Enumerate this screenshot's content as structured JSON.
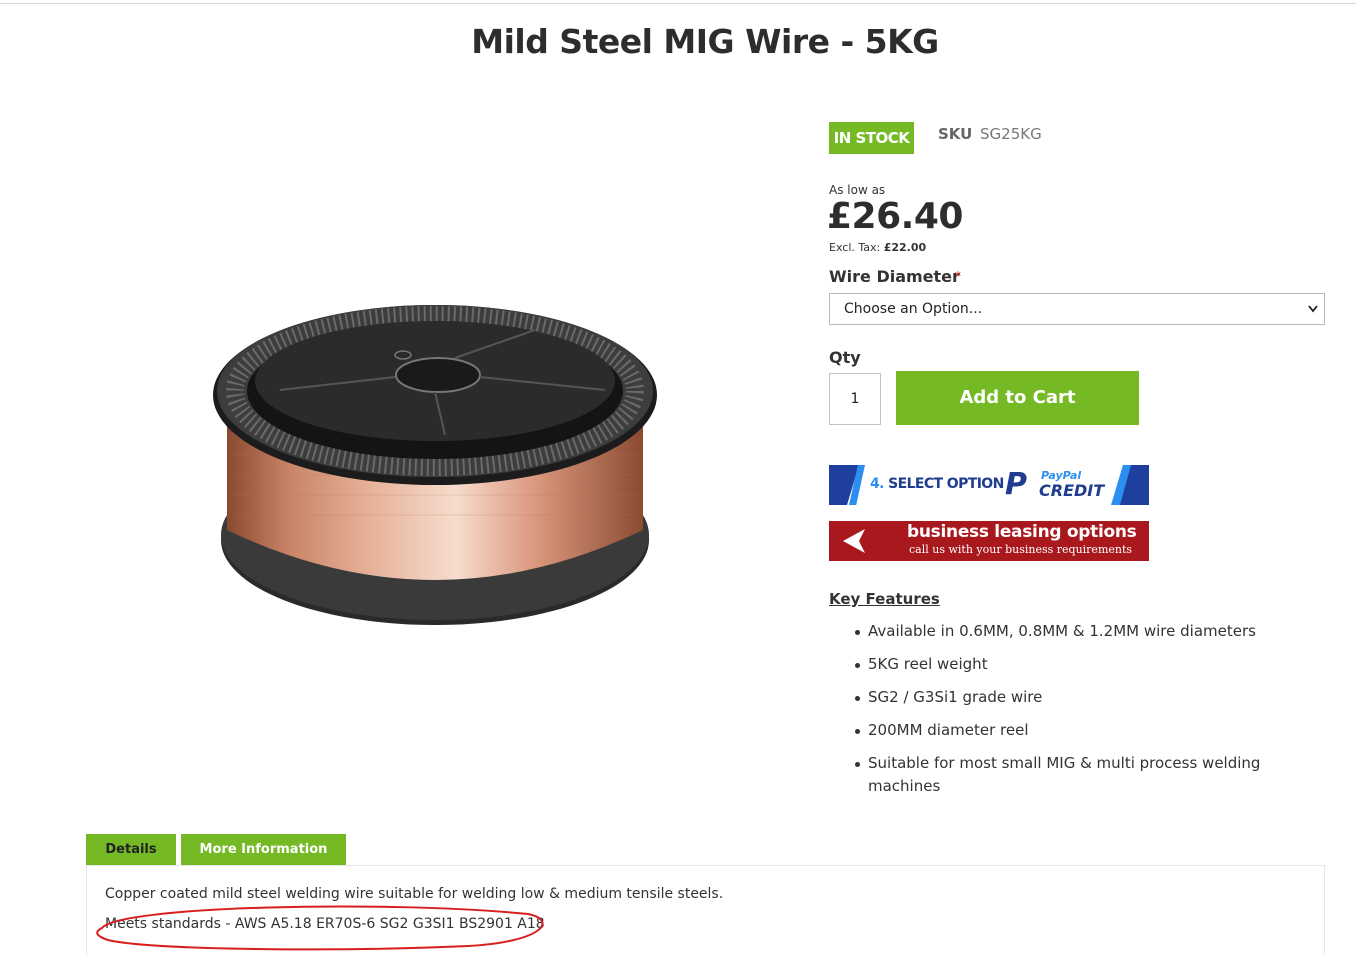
{
  "product": {
    "title": "Mild Steel MIG Wire - 5KG",
    "stock_status": "IN STOCK",
    "sku_label": "SKU",
    "sku_value": "SG25KG",
    "as_low_as": "As low as",
    "price": "£26.40",
    "excl_tax_label": "Excl. Tax:",
    "excl_tax_value": "£22.00"
  },
  "options": {
    "wire_diameter_label": "Wire Diameter",
    "required_mark": "*",
    "select_value": "Choose an Option..."
  },
  "cart": {
    "qty_label": "Qty",
    "qty_value": "1",
    "add_to_cart": "Add to Cart"
  },
  "banners": {
    "paypal_step_num": "4.",
    "paypal_step_text": "SELECT OPTION",
    "paypal_p": "P",
    "paypal_name": "PayPal",
    "paypal_credit": "CREDIT",
    "leasing_title": "business leasing options",
    "leasing_sub": "call us with your business requirements"
  },
  "key_features": {
    "title": "Key Features",
    "items": [
      "Available in 0.6MM, 0.8MM & 1.2MM wire diameters",
      "5KG reel weight",
      "SG2 / G3Si1 grade wire",
      "200MM diameter reel",
      "Suitable for most small MIG & multi process welding machines"
    ]
  },
  "tabs": {
    "details": "Details",
    "more_info": "More Information"
  },
  "description": {
    "line1": "Copper coated mild steel welding wire suitable for welding low & medium tensile steels.",
    "line2": "Meets standards - AWS A5.18 ER70S-6 SG2 G3SI1 BS2901 A18"
  },
  "colors": {
    "accent_green": "#75ba24",
    "leasing_red": "#a8181d",
    "paypal_blue": "#1f3c8e"
  }
}
